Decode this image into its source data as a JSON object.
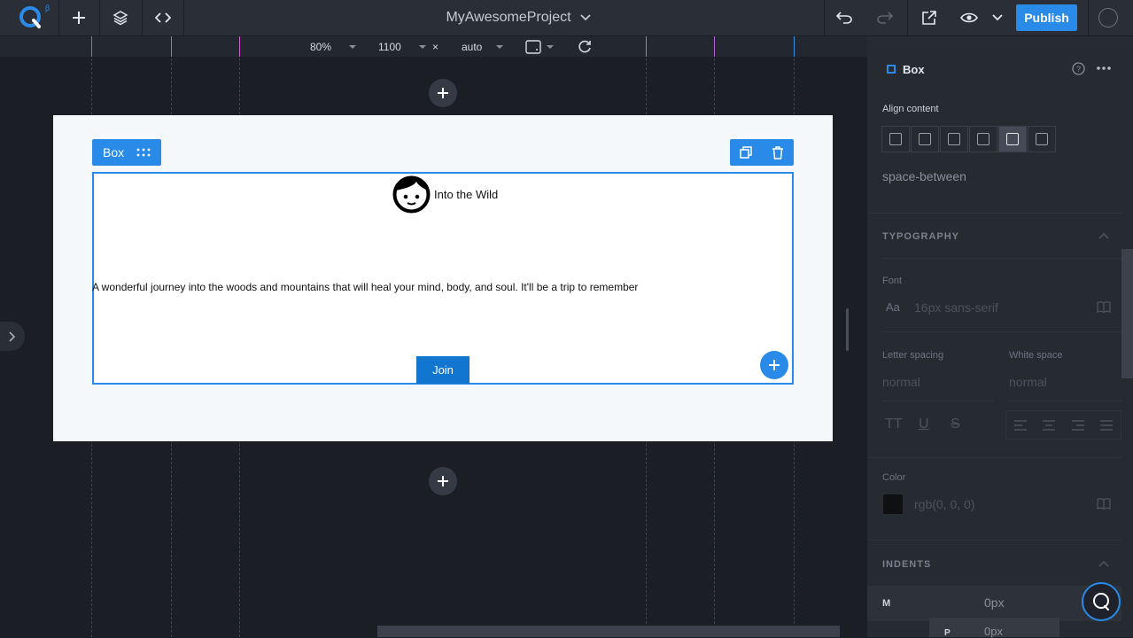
{
  "topbar": {
    "logo_text": "Q",
    "beta": "β",
    "project_name": "MyAwesomeProject",
    "publish_label": "Publish"
  },
  "viewport": {
    "zoom": "80%",
    "width": "1100",
    "times": "×",
    "height": "auto"
  },
  "canvas": {
    "selection_label": "Box",
    "heading": "Into the Wild",
    "paragraph": "A wonderful journey into the woods and mountains that will heal your mind, body, and soul. It'll be a trip to remember",
    "join_label": "Join"
  },
  "panel": {
    "title": "Box",
    "align_content_label": "Align content",
    "align_content_value": "space-between",
    "typography_title": "TYPOGRAPHY",
    "font_label": "Font",
    "font_aa": "Aa",
    "font_value": "16px sans-serif",
    "letter_spacing_label": "Letter spacing",
    "letter_spacing_value": "normal",
    "white_space_label": "White space",
    "white_space_value": "normal",
    "tt_label": "TT",
    "u_label": "U",
    "s_label": "S",
    "color_label": "Color",
    "color_value": "rgb(0, 0, 0)",
    "indents_title": "INDENTS",
    "margin_label": "M",
    "margin_value": "0px",
    "padding_label": "P",
    "padding_value": "0px"
  },
  "colors": {
    "accent": "#2a8ae8",
    "app_bg": "#1b1e25",
    "panel_bg": "#262a31",
    "join_bg": "#1276d0"
  }
}
